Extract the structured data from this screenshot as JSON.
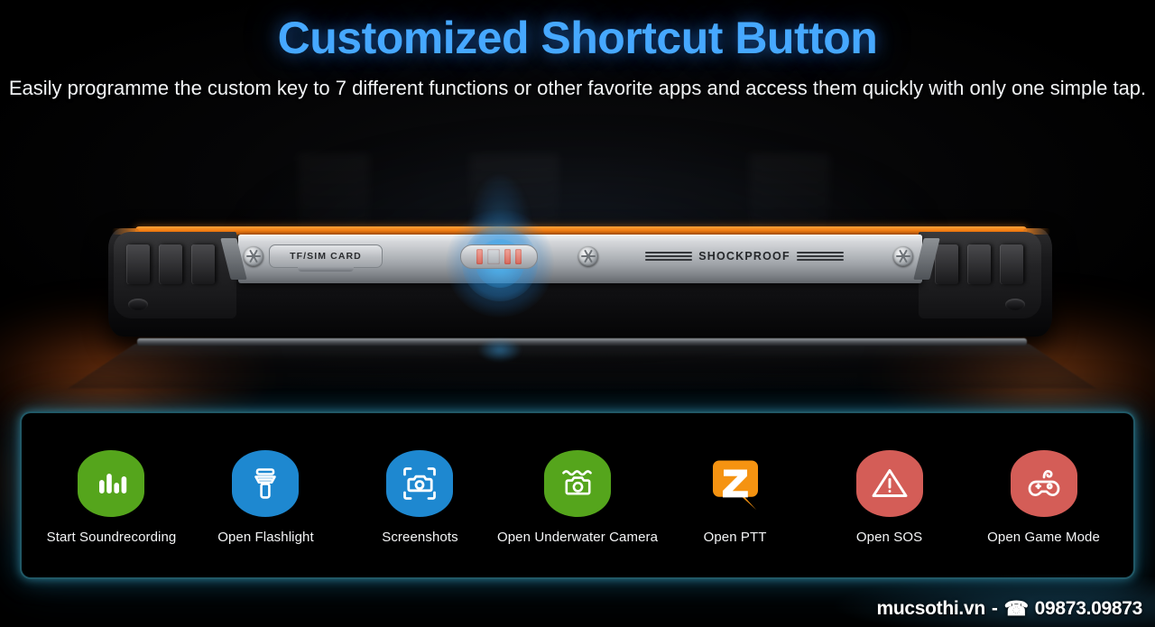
{
  "header": {
    "title": "Customized Shortcut Button",
    "subtitle": "Easily programme the custom key to 7 different functions or other favorite apps and access them quickly with only one simple tap.",
    "title_color": "#46a8ff",
    "subtitle_color": "#f2f4f6"
  },
  "phone": {
    "sim_door_label": "TF/SIM CARD",
    "shockproof_label": "SHOCKPROOF",
    "accent_color": "#f07a10",
    "highlight_glow_color": "#3ca6ea"
  },
  "panel": {
    "border_color": "#3ca0b9",
    "background_color": "#000000",
    "shortcuts": [
      {
        "label": "Start Soundrecording",
        "icon": "sound-recorder-icon",
        "color": "#55a51c"
      },
      {
        "label": "Open Flashlight",
        "icon": "flashlight-icon",
        "color": "#1e88d0"
      },
      {
        "label": "Screenshots",
        "icon": "screenshot-camera-icon",
        "color": "#1e88d0"
      },
      {
        "label": "Open Underwater Camera",
        "icon": "underwater-camera-icon",
        "color": "#55a51c"
      },
      {
        "label": "Open PTT",
        "icon": "ptt-zello-icon",
        "color": "#f59311"
      },
      {
        "label": "Open SOS",
        "icon": "sos-warning-icon",
        "color": "#d45d57"
      },
      {
        "label": "Open Game Mode",
        "icon": "game-controller-icon",
        "color": "#d45d57"
      }
    ]
  },
  "watermark": {
    "site": "mucsothi.vn",
    "separator": "-",
    "phone_glyph": "☎",
    "phone_number": "09873.09873"
  }
}
